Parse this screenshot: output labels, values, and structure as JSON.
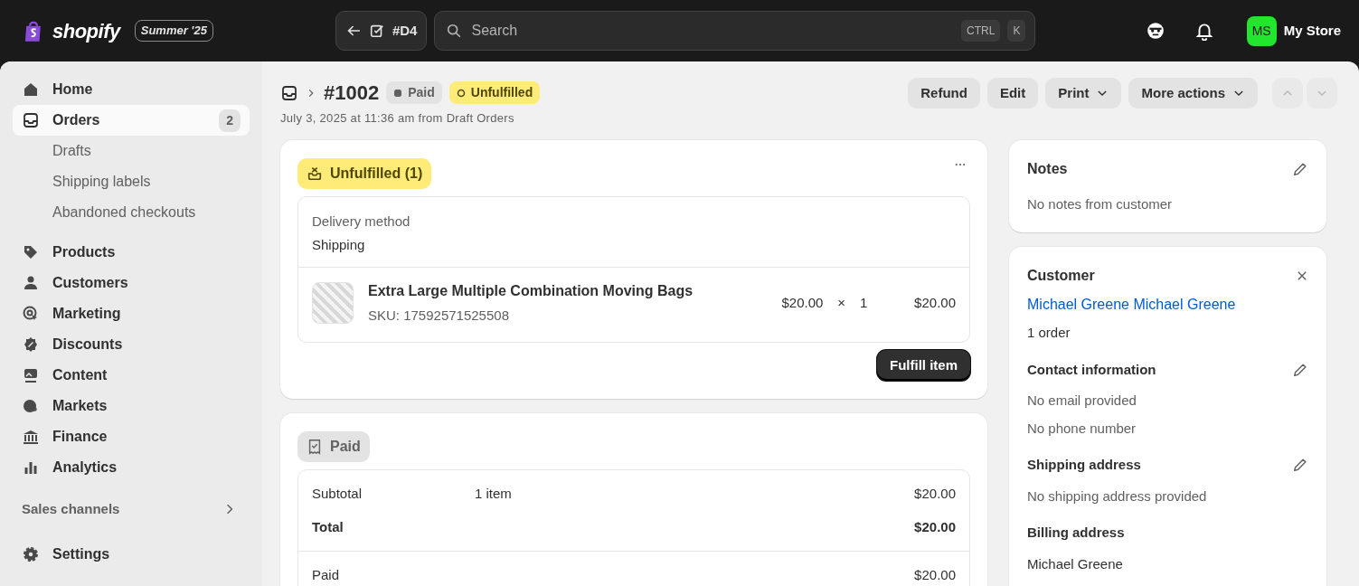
{
  "top_bar": {
    "logo_text": "shopify",
    "edition_badge": "Summer '25",
    "draft_chip": "#D4",
    "search": {
      "placeholder": "Search",
      "shortcut_keys": [
        "CTRL",
        "K"
      ]
    },
    "avatar_initials": "MS",
    "store_name": "My Store"
  },
  "sidebar": {
    "items": [
      {
        "label": "Home",
        "selected": false
      },
      {
        "label": "Orders",
        "selected": true,
        "count": "2",
        "children": [
          {
            "label": "Drafts",
            "selected": false
          },
          {
            "label": "Shipping labels",
            "selected": false
          },
          {
            "label": "Abandoned checkouts",
            "selected": false
          }
        ]
      },
      {
        "label": "Products",
        "selected": false
      },
      {
        "label": "Customers",
        "selected": false
      },
      {
        "label": "Marketing",
        "selected": false
      },
      {
        "label": "Discounts",
        "selected": false
      },
      {
        "label": "Content",
        "selected": false
      },
      {
        "label": "Markets",
        "selected": false
      },
      {
        "label": "Finance",
        "selected": false
      },
      {
        "label": "Analytics",
        "selected": false
      }
    ],
    "sales_channels": "Sales channels",
    "settings": "Settings"
  },
  "header": {
    "order_number": "#1002",
    "badges": [
      {
        "label": "Paid",
        "kind": "paid"
      },
      {
        "label": "Unfulfilled",
        "kind": "unfulfilled"
      }
    ],
    "subtitle": "July 3, 2025 at 11:36 am from Draft Orders",
    "actions": [
      {
        "label": "Refund",
        "dropdown": false
      },
      {
        "label": "Edit",
        "dropdown": false
      },
      {
        "label": "Print",
        "dropdown": true
      },
      {
        "label": "More actions",
        "dropdown": true
      }
    ],
    "pager": [
      {
        "kind": "previous",
        "disabled": true
      },
      {
        "kind": "next",
        "disabled": true
      }
    ]
  },
  "fulfillment_card": {
    "status": "Unfulfilled (1)",
    "delivery_label": "Delivery method",
    "delivery_value": "Shipping",
    "line_items": [
      {
        "title": "Extra Large Multiple Combination Moving Bags",
        "sku": "SKU: 17592571525508",
        "price": "$20.00",
        "times": "×",
        "quantity": "1",
        "total": "$20.00"
      }
    ],
    "button": "Fulfill item"
  },
  "payment_card": {
    "status": "Paid",
    "summary_rows": [
      {
        "label": "Subtotal",
        "detail": "1 item",
        "amount": "$20.00",
        "bold": false
      },
      {
        "label": "Total",
        "amount": "$20.00",
        "bold": true
      }
    ],
    "paid_rows": [
      {
        "label": "Paid",
        "amount": "$20.00",
        "bold": false
      }
    ]
  },
  "notes_card": {
    "title": "Notes",
    "text": "No notes from customer"
  },
  "customer_card": {
    "title": "Customer",
    "name_link": "Michael Greene Michael Greene",
    "orders": "1 order",
    "sections": [
      {
        "title": "Contact information",
        "editable": true,
        "lines": [
          "No email provided",
          "No phone number"
        ]
      },
      {
        "title": "Shipping address",
        "editable": true,
        "lines": [
          "No shipping address provided"
        ]
      },
      {
        "title": "Billing address",
        "editable": false,
        "lines": [
          "Michael Greene"
        ]
      }
    ]
  }
}
